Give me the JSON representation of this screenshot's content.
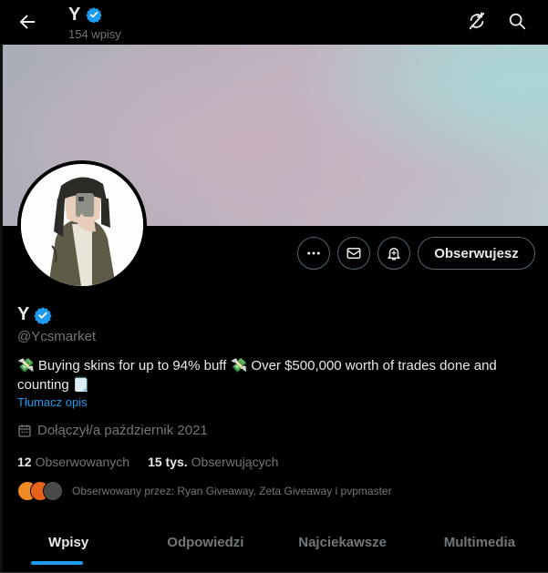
{
  "header": {
    "title": "Y",
    "post_count": "154 wpisy"
  },
  "profile": {
    "name": "Y",
    "handle": "@Ycsmarket",
    "bio_parts": [
      "💸",
      " Buying skins for up to 94% buff ",
      "💸",
      " Over $500,000 worth of trades done and counting ",
      "🗒️"
    ],
    "translate": "Tłumacz opis",
    "joined": "Dołączył/a październik 2021",
    "following_count": "12",
    "following_label": "Obserwowanych",
    "followers_count": "15 tys.",
    "followers_label": "Obserwujących",
    "followed_by": "Obserwowany przez: Ryan Giveaway, Zeta Giveaway i pvpmaster",
    "follow_button": "Obserwujesz"
  },
  "tabs": [
    "Wpisy",
    "Odpowiedzi",
    "Najciekawsze",
    "Multimedia"
  ],
  "active_tab": "Wpisy",
  "colors": {
    "accent": "#1d9bf0",
    "background": "#000000",
    "text_primary": "#e7e9ea",
    "text_secondary": "#71767b"
  },
  "icons": [
    "back-arrow-icon",
    "verified-badge-icon",
    "refresh-icon",
    "search-icon",
    "more-icon",
    "message-icon",
    "notification-bell-icon",
    "calendar-icon"
  ]
}
